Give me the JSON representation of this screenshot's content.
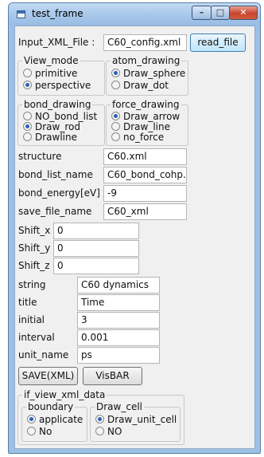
{
  "window": {
    "title": "test_frame",
    "min_glyph": "–",
    "max_glyph": "□",
    "close_glyph": "✕"
  },
  "input_xml": {
    "label": "Input_XML_File :",
    "value": "C60_config.xml",
    "button": "read_file"
  },
  "view_mode": {
    "title": "View_mode",
    "options": [
      "primitive",
      "perspective"
    ],
    "selected": "perspective"
  },
  "atom_drawing": {
    "title": "atom_drawing",
    "options": [
      "Draw_sphere",
      "Draw_dot"
    ],
    "selected": "Draw_sphere"
  },
  "bond_drawing": {
    "title": "bond_drawing",
    "options": [
      "NO_bond_list",
      "Draw_rod",
      "Drawline"
    ],
    "selected": "Draw_rod"
  },
  "force_drawing": {
    "title": "force_drawing",
    "options": [
      "Draw_arrow",
      "Draw_line",
      "no_force"
    ],
    "selected": "Draw_arrow"
  },
  "fields_a": [
    {
      "label": "structure",
      "value": "C60.xml"
    },
    {
      "label": "bond_list_name",
      "value": "C60_bond_cohp."
    },
    {
      "label": "bond_energy[eV]",
      "value": "-9"
    },
    {
      "label": "save_file_name",
      "value": "C60_xml"
    }
  ],
  "shifts": [
    {
      "label": "Shift_x",
      "value": "0"
    },
    {
      "label": "Shift_y",
      "value": "0"
    },
    {
      "label": "Shift_z",
      "value": "0"
    }
  ],
  "fields_b": [
    {
      "label": "string",
      "value": "C60 dynamics"
    },
    {
      "label": "title",
      "value": "Time"
    },
    {
      "label": "initial",
      "value": "3"
    },
    {
      "label": "interval",
      "value": "0.001"
    },
    {
      "label": "unit_name",
      "value": "ps"
    }
  ],
  "buttons": {
    "save": "SAVE(XML)",
    "visbar": "VisBAR"
  },
  "if_view": {
    "title": "if_view_xml_data",
    "boundary": {
      "title": "boundary",
      "options": [
        "applicate",
        "No"
      ],
      "selected": "applicate"
    },
    "draw_cell": {
      "title": "Draw_cell",
      "options": [
        "Draw_unit_cell",
        "NO"
      ],
      "selected": "Draw_unit_cell"
    }
  }
}
